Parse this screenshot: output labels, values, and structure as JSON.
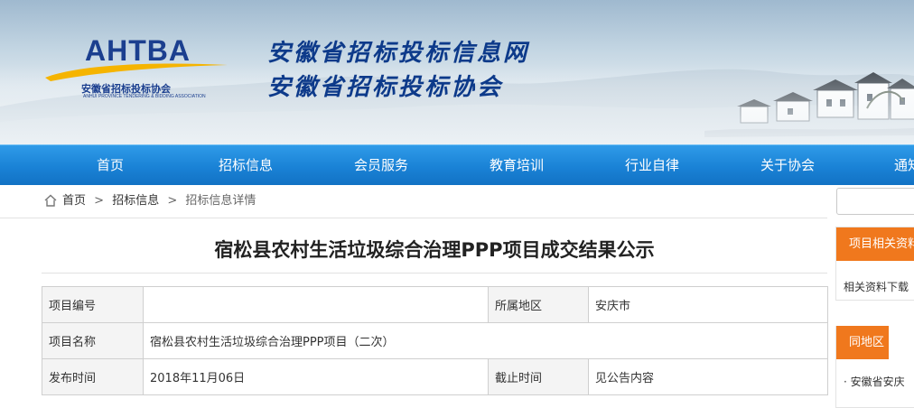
{
  "header": {
    "logo_mark": "AHTBA",
    "logo_cn": "安徽省招标投标协会",
    "logo_en": "ANHUI PROVINCE TENDERING & BIDDING ASSOCIATION",
    "title_line1": "安徽省招标投标信息网",
    "title_line2": "安徽省招标投标协会"
  },
  "nav": {
    "items": [
      {
        "label": "首页"
      },
      {
        "label": "招标信息"
      },
      {
        "label": "会员服务"
      },
      {
        "label": "教育培训"
      },
      {
        "label": "行业自律"
      },
      {
        "label": "关于协会"
      },
      {
        "label": "通知"
      }
    ]
  },
  "breadcrumb": {
    "home": "首页",
    "section": "招标信息",
    "current": "招标信息详情",
    "separator": ">"
  },
  "article": {
    "title": "宿松县农村生活垃圾综合治理PPP项目成交结果公示",
    "rows": [
      {
        "label": "项目编号",
        "value": "",
        "label2": "所属地区",
        "value2": "安庆市"
      },
      {
        "label": "项目名称",
        "value": "宿松县农村生活垃圾综合治理PPP项目（二次）"
      },
      {
        "label": "发布时间",
        "value": "2018年11月06日",
        "label2": "截止时间",
        "value2": "见公告内容"
      }
    ]
  },
  "sidebar": {
    "search_placeholder": "",
    "panel1_title": "项目相关资料",
    "panel1_item": "相关资料下载",
    "panel2_title": "同地区",
    "panel2_item": "安徽省安庆"
  },
  "colors": {
    "nav": "#1a82d6",
    "accent_orange": "#f0781d",
    "logo_blue": "#1b3f8f",
    "logo_gold": "#f5b400"
  }
}
